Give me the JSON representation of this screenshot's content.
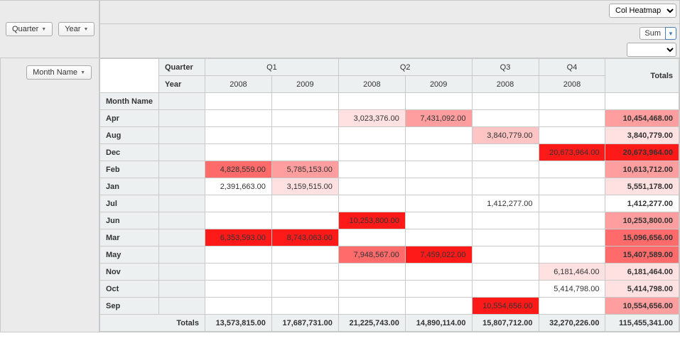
{
  "controls": {
    "display_mode": "Col Heatmap",
    "aggregator": "Sum",
    "value_field": "",
    "col_pills": [
      {
        "id": "quarter",
        "label": "Quarter"
      },
      {
        "id": "year",
        "label": "Year"
      }
    ],
    "row_pills": [
      {
        "id": "month-name",
        "label": "Month Name"
      }
    ]
  },
  "pivot": {
    "col_header_rows": [
      {
        "label": "Quarter",
        "spans": [
          {
            "label": "Q1",
            "colspan": 2
          },
          {
            "label": "Q2",
            "colspan": 2
          },
          {
            "label": "Q3",
            "colspan": 1
          },
          {
            "label": "Q4",
            "colspan": 1
          }
        ]
      },
      {
        "label": "Year",
        "cells": [
          "2008",
          "2009",
          "2008",
          "2009",
          "2008",
          "2008"
        ]
      }
    ],
    "row_header": "Month Name",
    "totals_label": "Totals",
    "columns": [
      "Q1-2008",
      "Q1-2009",
      "Q2-2008",
      "Q2-2009",
      "Q3-2008",
      "Q4-2008"
    ],
    "rows": [
      {
        "name": "Apr",
        "cells": [
          "",
          "",
          "3,023,376.00",
          "7,431,092.00",
          "",
          ""
        ],
        "total": "10,454,468.00",
        "heat": [
          "",
          "",
          "h1",
          "h3",
          "",
          ""
        ],
        "theat": "h3"
      },
      {
        "name": "Aug",
        "cells": [
          "",
          "",
          "",
          "",
          "3,840,779.00",
          ""
        ],
        "total": "3,840,779.00",
        "heat": [
          "",
          "",
          "",
          "",
          "h2",
          ""
        ],
        "theat": "h1"
      },
      {
        "name": "Dec",
        "cells": [
          "",
          "",
          "",
          "",
          "",
          "20,673,964.00"
        ],
        "total": "20,673,964.00",
        "heat": [
          "",
          "",
          "",
          "",
          "",
          "h5"
        ],
        "theat": "h5"
      },
      {
        "name": "Feb",
        "cells": [
          "4,828,559.00",
          "5,785,153.00",
          "",
          "",
          "",
          ""
        ],
        "total": "10,613,712.00",
        "heat": [
          "h4",
          "h3",
          "",
          "",
          "",
          ""
        ],
        "theat": "h3"
      },
      {
        "name": "Jan",
        "cells": [
          "2,391,663.00",
          "3,159,515.00",
          "",
          "",
          "",
          ""
        ],
        "total": "5,551,178.00",
        "heat": [
          "h0",
          "h1",
          "",
          "",
          "",
          ""
        ],
        "theat": "h1"
      },
      {
        "name": "Jul",
        "cells": [
          "",
          "",
          "",
          "",
          "1,412,277.00",
          ""
        ],
        "total": "1,412,277.00",
        "heat": [
          "",
          "",
          "",
          "",
          "h0",
          ""
        ],
        "theat": "h0"
      },
      {
        "name": "Jun",
        "cells": [
          "",
          "",
          "10,253,800.00",
          "",
          "",
          ""
        ],
        "total": "10,253,800.00",
        "heat": [
          "",
          "",
          "h5",
          "",
          "",
          ""
        ],
        "theat": "h3"
      },
      {
        "name": "Mar",
        "cells": [
          "6,353,593.00",
          "8,743,063.00",
          "",
          "",
          "",
          ""
        ],
        "total": "15,096,656.00",
        "heat": [
          "h5",
          "h5",
          "",
          "",
          "",
          ""
        ],
        "theat": "h4"
      },
      {
        "name": "May",
        "cells": [
          "",
          "",
          "7,948,567.00",
          "7,459,022.00",
          "",
          ""
        ],
        "total": "15,407,589.00",
        "heat": [
          "",
          "",
          "h4",
          "h5",
          "",
          ""
        ],
        "theat": "h4"
      },
      {
        "name": "Nov",
        "cells": [
          "",
          "",
          "",
          "",
          "",
          "6,181,464.00"
        ],
        "total": "6,181,464.00",
        "heat": [
          "",
          "",
          "",
          "",
          "",
          "h1"
        ],
        "theat": "h1"
      },
      {
        "name": "Oct",
        "cells": [
          "",
          "",
          "",
          "",
          "",
          "5,414,798.00"
        ],
        "total": "5,414,798.00",
        "heat": [
          "",
          "",
          "",
          "",
          "",
          "h0"
        ],
        "theat": "h1"
      },
      {
        "name": "Sep",
        "cells": [
          "",
          "",
          "",
          "",
          "10,554,656.00",
          ""
        ],
        "total": "10,554,656.00",
        "heat": [
          "",
          "",
          "",
          "",
          "h5",
          ""
        ],
        "theat": "h3"
      }
    ],
    "col_totals": [
      "13,573,815.00",
      "17,687,731.00",
      "21,225,743.00",
      "14,890,114.00",
      "15,807,712.00",
      "32,270,226.00"
    ],
    "grand_total": "115,455,341.00",
    "heat_colors": {
      "h0": "#ffffff",
      "h1": "#ffe1e1",
      "h2": "#ffc4c4",
      "h3": "#ff9e9e",
      "h4": "#ff6b6b",
      "h5": "#ff1a1a"
    }
  },
  "chart_data": {
    "type": "heatmap",
    "title": "",
    "row_field": "Month Name",
    "col_fields": [
      "Quarter",
      "Year"
    ],
    "aggregator": "Sum",
    "display": "Col Heatmap",
    "columns": [
      {
        "quarter": "Q1",
        "year": 2008
      },
      {
        "quarter": "Q1",
        "year": 2009
      },
      {
        "quarter": "Q2",
        "year": 2008
      },
      {
        "quarter": "Q2",
        "year": 2009
      },
      {
        "quarter": "Q3",
        "year": 2008
      },
      {
        "quarter": "Q4",
        "year": 2008
      }
    ],
    "rows": [
      "Apr",
      "Aug",
      "Dec",
      "Feb",
      "Jan",
      "Jul",
      "Jun",
      "Mar",
      "May",
      "Nov",
      "Oct",
      "Sep"
    ],
    "values": [
      [
        null,
        null,
        3023376.0,
        7431092.0,
        null,
        null
      ],
      [
        null,
        null,
        null,
        null,
        3840779.0,
        null
      ],
      [
        null,
        null,
        null,
        null,
        null,
        20673964.0
      ],
      [
        4828559.0,
        5785153.0,
        null,
        null,
        null,
        null
      ],
      [
        2391663.0,
        3159515.0,
        null,
        null,
        null,
        null
      ],
      [
        null,
        null,
        null,
        null,
        1412277.0,
        null
      ],
      [
        null,
        null,
        10253800.0,
        null,
        null,
        null
      ],
      [
        6353593.0,
        8743063.0,
        null,
        null,
        null,
        null
      ],
      [
        null,
        null,
        7948567.0,
        7459022.0,
        null,
        null
      ],
      [
        null,
        null,
        null,
        null,
        null,
        6181464.0
      ],
      [
        null,
        null,
        null,
        null,
        null,
        5414798.0
      ],
      [
        null,
        null,
        null,
        null,
        10554656.0,
        null
      ]
    ],
    "row_totals": [
      10454468.0,
      3840779.0,
      20673964.0,
      10613712.0,
      5551178.0,
      1412277.0,
      10253800.0,
      15096656.0,
      15407589.0,
      6181464.0,
      5414798.0,
      10554656.0
    ],
    "col_totals": [
      13573815.0,
      17687731.0,
      21225743.0,
      14890114.0,
      15807712.0,
      32270226.0
    ],
    "grand_total": 115455341.0
  }
}
